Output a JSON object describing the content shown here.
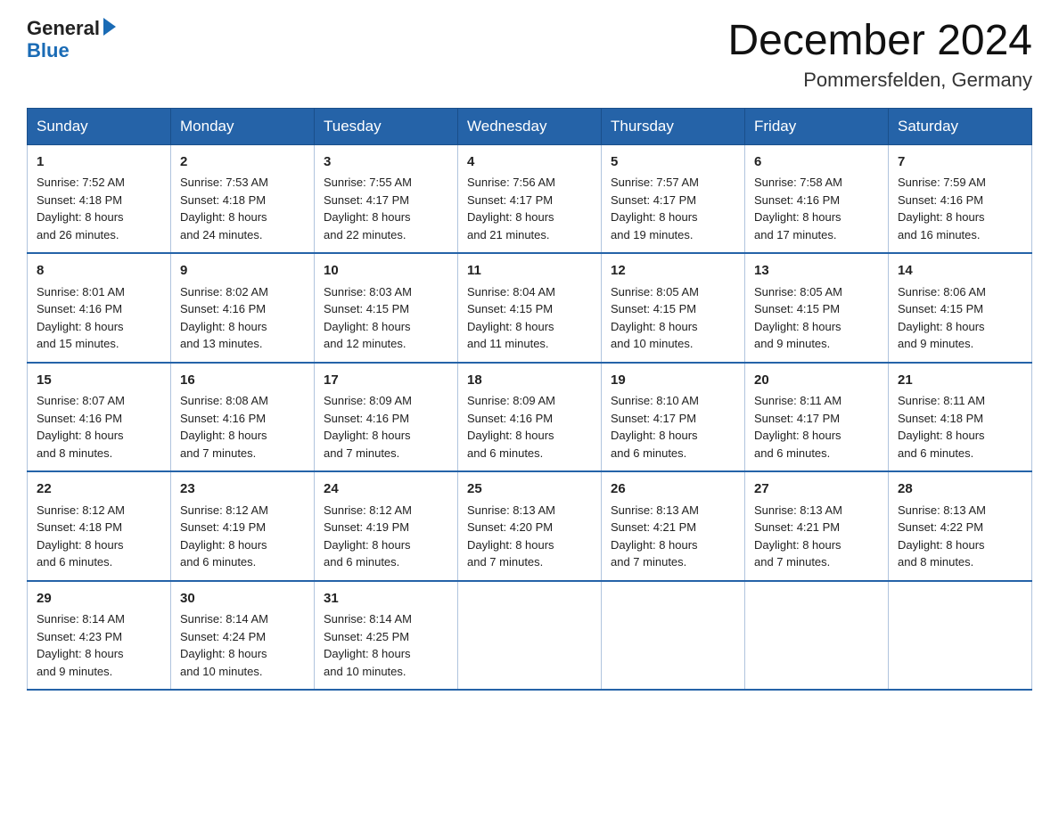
{
  "header": {
    "logo_general": "General",
    "logo_blue": "Blue",
    "title": "December 2024",
    "subtitle": "Pommersfelden, Germany"
  },
  "days_of_week": [
    "Sunday",
    "Monday",
    "Tuesday",
    "Wednesday",
    "Thursday",
    "Friday",
    "Saturday"
  ],
  "weeks": [
    [
      {
        "day": "1",
        "sunrise": "7:52 AM",
        "sunset": "4:18 PM",
        "daylight": "8 hours and 26 minutes."
      },
      {
        "day": "2",
        "sunrise": "7:53 AM",
        "sunset": "4:18 PM",
        "daylight": "8 hours and 24 minutes."
      },
      {
        "day": "3",
        "sunrise": "7:55 AM",
        "sunset": "4:17 PM",
        "daylight": "8 hours and 22 minutes."
      },
      {
        "day": "4",
        "sunrise": "7:56 AM",
        "sunset": "4:17 PM",
        "daylight": "8 hours and 21 minutes."
      },
      {
        "day": "5",
        "sunrise": "7:57 AM",
        "sunset": "4:17 PM",
        "daylight": "8 hours and 19 minutes."
      },
      {
        "day": "6",
        "sunrise": "7:58 AM",
        "sunset": "4:16 PM",
        "daylight": "8 hours and 17 minutes."
      },
      {
        "day": "7",
        "sunrise": "7:59 AM",
        "sunset": "4:16 PM",
        "daylight": "8 hours and 16 minutes."
      }
    ],
    [
      {
        "day": "8",
        "sunrise": "8:01 AM",
        "sunset": "4:16 PM",
        "daylight": "8 hours and 15 minutes."
      },
      {
        "day": "9",
        "sunrise": "8:02 AM",
        "sunset": "4:16 PM",
        "daylight": "8 hours and 13 minutes."
      },
      {
        "day": "10",
        "sunrise": "8:03 AM",
        "sunset": "4:15 PM",
        "daylight": "8 hours and 12 minutes."
      },
      {
        "day": "11",
        "sunrise": "8:04 AM",
        "sunset": "4:15 PM",
        "daylight": "8 hours and 11 minutes."
      },
      {
        "day": "12",
        "sunrise": "8:05 AM",
        "sunset": "4:15 PM",
        "daylight": "8 hours and 10 minutes."
      },
      {
        "day": "13",
        "sunrise": "8:05 AM",
        "sunset": "4:15 PM",
        "daylight": "8 hours and 9 minutes."
      },
      {
        "day": "14",
        "sunrise": "8:06 AM",
        "sunset": "4:15 PM",
        "daylight": "8 hours and 9 minutes."
      }
    ],
    [
      {
        "day": "15",
        "sunrise": "8:07 AM",
        "sunset": "4:16 PM",
        "daylight": "8 hours and 8 minutes."
      },
      {
        "day": "16",
        "sunrise": "8:08 AM",
        "sunset": "4:16 PM",
        "daylight": "8 hours and 7 minutes."
      },
      {
        "day": "17",
        "sunrise": "8:09 AM",
        "sunset": "4:16 PM",
        "daylight": "8 hours and 7 minutes."
      },
      {
        "day": "18",
        "sunrise": "8:09 AM",
        "sunset": "4:16 PM",
        "daylight": "8 hours and 6 minutes."
      },
      {
        "day": "19",
        "sunrise": "8:10 AM",
        "sunset": "4:17 PM",
        "daylight": "8 hours and 6 minutes."
      },
      {
        "day": "20",
        "sunrise": "8:11 AM",
        "sunset": "4:17 PM",
        "daylight": "8 hours and 6 minutes."
      },
      {
        "day": "21",
        "sunrise": "8:11 AM",
        "sunset": "4:18 PM",
        "daylight": "8 hours and 6 minutes."
      }
    ],
    [
      {
        "day": "22",
        "sunrise": "8:12 AM",
        "sunset": "4:18 PM",
        "daylight": "8 hours and 6 minutes."
      },
      {
        "day": "23",
        "sunrise": "8:12 AM",
        "sunset": "4:19 PM",
        "daylight": "8 hours and 6 minutes."
      },
      {
        "day": "24",
        "sunrise": "8:12 AM",
        "sunset": "4:19 PM",
        "daylight": "8 hours and 6 minutes."
      },
      {
        "day": "25",
        "sunrise": "8:13 AM",
        "sunset": "4:20 PM",
        "daylight": "8 hours and 7 minutes."
      },
      {
        "day": "26",
        "sunrise": "8:13 AM",
        "sunset": "4:21 PM",
        "daylight": "8 hours and 7 minutes."
      },
      {
        "day": "27",
        "sunrise": "8:13 AM",
        "sunset": "4:21 PM",
        "daylight": "8 hours and 7 minutes."
      },
      {
        "day": "28",
        "sunrise": "8:13 AM",
        "sunset": "4:22 PM",
        "daylight": "8 hours and 8 minutes."
      }
    ],
    [
      {
        "day": "29",
        "sunrise": "8:14 AM",
        "sunset": "4:23 PM",
        "daylight": "8 hours and 9 minutes."
      },
      {
        "day": "30",
        "sunrise": "8:14 AM",
        "sunset": "4:24 PM",
        "daylight": "8 hours and 10 minutes."
      },
      {
        "day": "31",
        "sunrise": "8:14 AM",
        "sunset": "4:25 PM",
        "daylight": "8 hours and 10 minutes."
      },
      null,
      null,
      null,
      null
    ]
  ],
  "labels": {
    "sunrise": "Sunrise:",
    "sunset": "Sunset:",
    "daylight": "Daylight:"
  }
}
